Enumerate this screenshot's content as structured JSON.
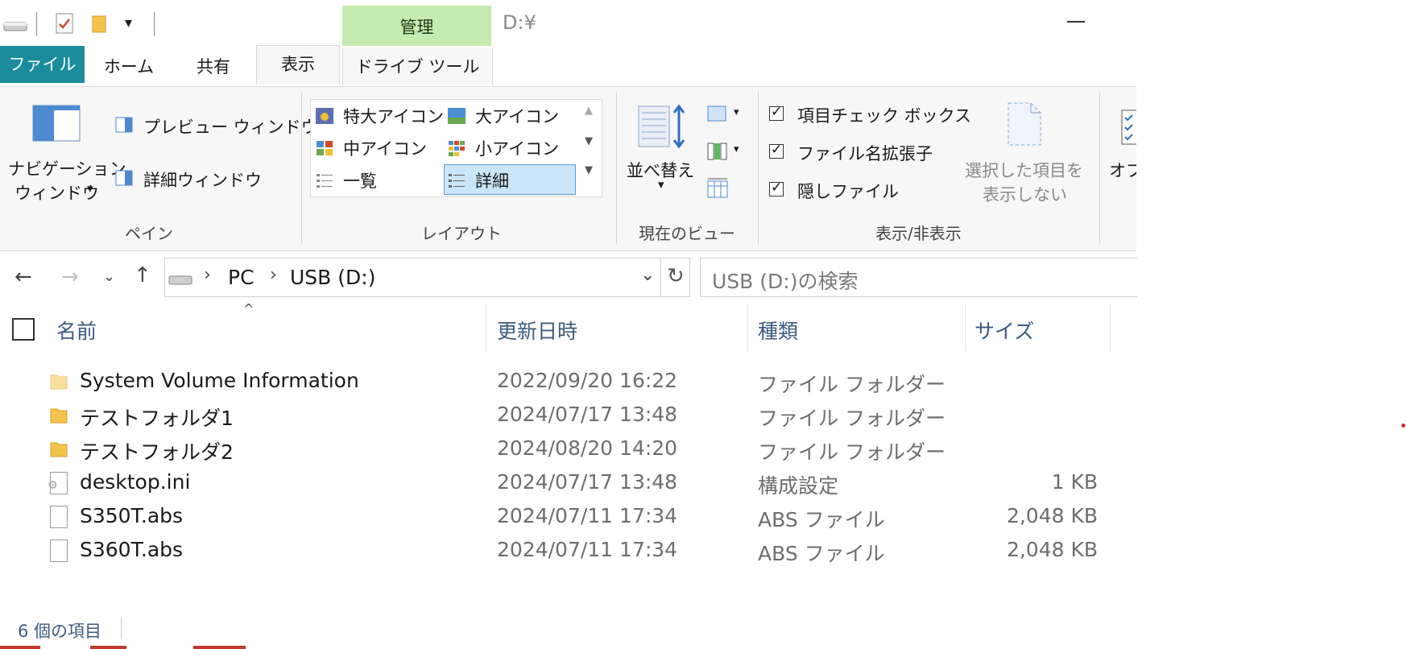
{
  "titlebar": {
    "manage_label": "管理",
    "path_title": "D:¥"
  },
  "tabs": {
    "file": "ファイル",
    "home": "ホーム",
    "share": "共有",
    "view": "表示",
    "drive_tools": "ドライブ ツール"
  },
  "ribbon": {
    "pane": {
      "nav_pane_line1": "ナビゲーション",
      "nav_pane_line2": "ウィンドウ",
      "preview": "プレビュー ウィンドウ",
      "details_pane": "詳細ウィンドウ",
      "group_label": "ペイン"
    },
    "layout": {
      "extra_large": "特大アイコン",
      "large": "大アイコン",
      "medium": "中アイコン",
      "small": "小アイコン",
      "list": "一覧",
      "details": "詳細",
      "group_label": "レイアウト"
    },
    "current_view": {
      "sort": "並べ替え",
      "group_label": "現在のビュー"
    },
    "show_hide": {
      "item_checkboxes": "項目チェック ボックス",
      "file_extensions": "ファイル名拡張子",
      "hidden_files": "隠しファイル",
      "hide_selected_line1": "選択した項目を",
      "hide_selected_line2": "表示しない",
      "group_label": "表示/非表示"
    },
    "options_partial": "オプ"
  },
  "address": {
    "crumbs": [
      "PC",
      "USB (D:)"
    ],
    "search_placeholder": "USB (D:)の検索"
  },
  "columns": {
    "name": "名前",
    "modified": "更新日時",
    "type": "種類",
    "size": "サイズ"
  },
  "files": [
    {
      "name": "System Volume Information",
      "modified": "2022/09/20 16:22",
      "type": "ファイル フォルダー",
      "size": "",
      "icon": "folder-icon",
      "faded": true
    },
    {
      "name": "テストフォルダ1",
      "modified": "2024/07/17 13:48",
      "type": "ファイル フォルダー",
      "size": "",
      "icon": "folder-icon"
    },
    {
      "name": "テストフォルダ2",
      "modified": "2024/08/20 14:20",
      "type": "ファイル フォルダー",
      "size": "",
      "icon": "folder-icon"
    },
    {
      "name": "desktop.ini",
      "modified": "2024/07/17 13:48",
      "type": "構成設定",
      "size": "1 KB",
      "icon": "settings-file-icon"
    },
    {
      "name": "S350T.abs",
      "modified": "2024/07/11 17:34",
      "type": "ABS ファイル",
      "size": "2,048 KB",
      "icon": "file-icon"
    },
    {
      "name": "S360T.abs",
      "modified": "2024/07/11 17:34",
      "type": "ABS ファイル",
      "size": "2,048 KB",
      "icon": "file-icon"
    }
  ],
  "status": {
    "item_count": "6 個の項目"
  },
  "colors": {
    "file_tab": "#1b8c9b",
    "manage_tab": "#c6ebb0",
    "header_text": "#3d5a80",
    "folder": "#f3c44b"
  }
}
